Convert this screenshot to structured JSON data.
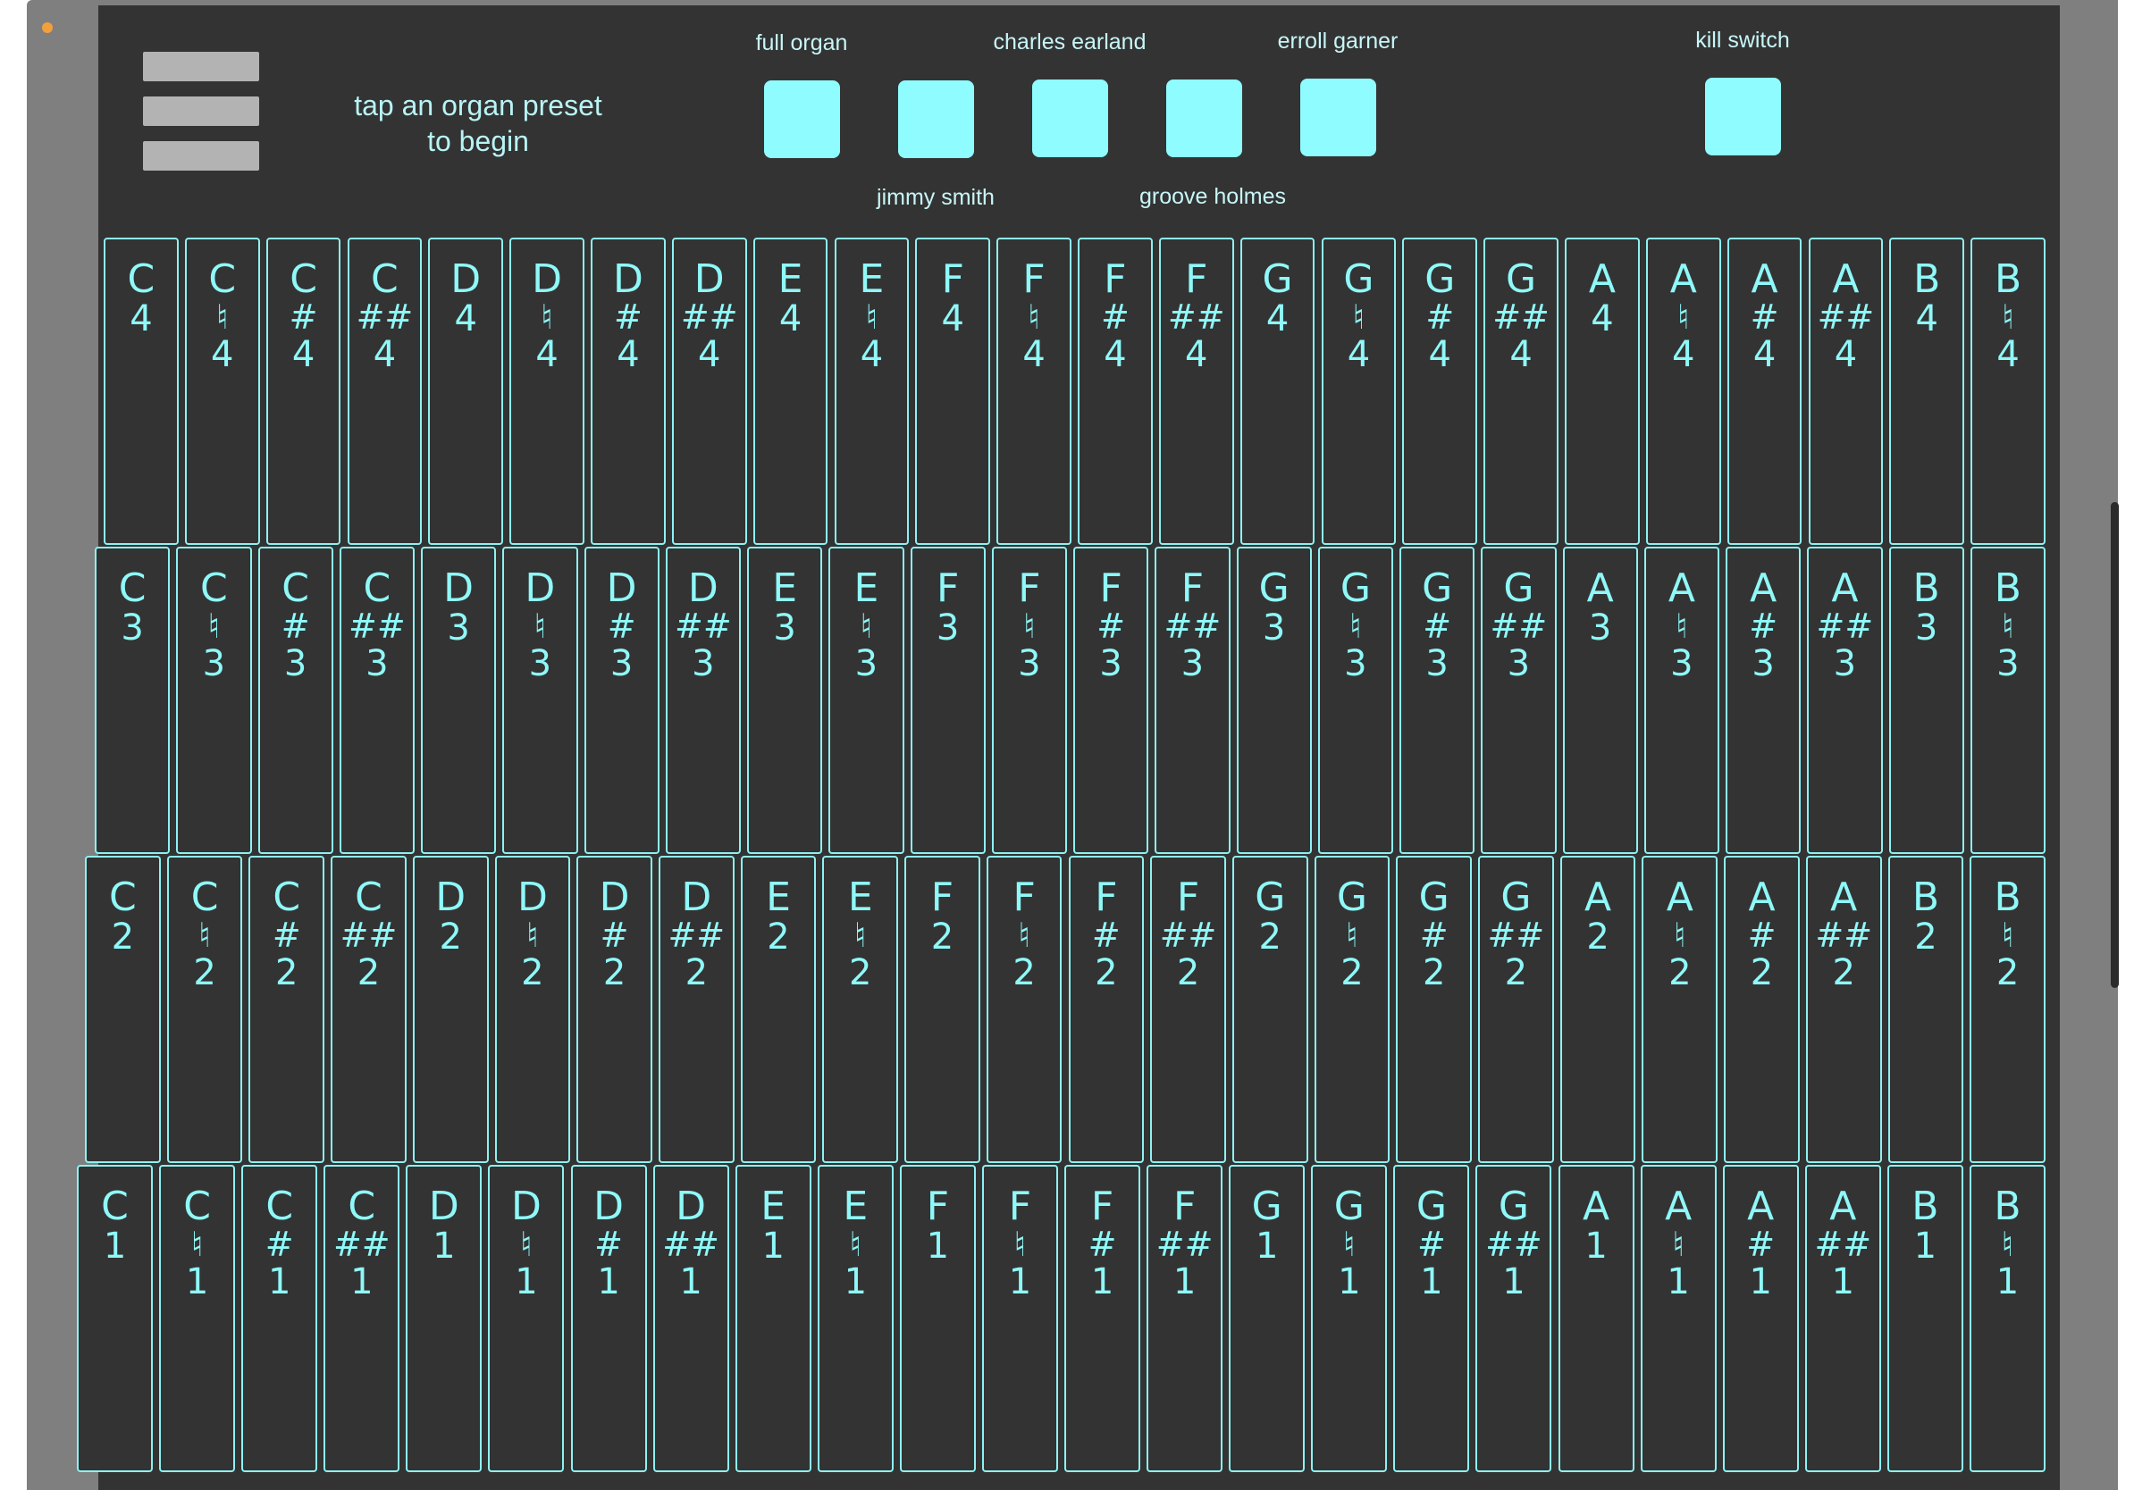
{
  "hint": "tap an organ preset\nto begin",
  "presets": [
    {
      "id": "full-organ",
      "label": "full organ",
      "label_pos": "top"
    },
    {
      "id": "jimmy-smith",
      "label": "jimmy smith",
      "label_pos": "bottom"
    },
    {
      "id": "charles-earland",
      "label": "charles earland",
      "label_pos": "top"
    },
    {
      "id": "groove-holmes",
      "label": "groove holmes",
      "label_pos": "bottom"
    },
    {
      "id": "erroll-garner",
      "label": "erroll garner",
      "label_pos": "top"
    }
  ],
  "kill_switch": {
    "label": "kill switch"
  },
  "colors": {
    "accent": "#8ffcff",
    "key_border": "#8ef1f1",
    "panel": "#333333"
  },
  "notes": [
    {
      "letter": "C",
      "mark": ""
    },
    {
      "letter": "C",
      "mark": "♮"
    },
    {
      "letter": "C",
      "mark": "#"
    },
    {
      "letter": "C",
      "mark": "##"
    },
    {
      "letter": "D",
      "mark": ""
    },
    {
      "letter": "D",
      "mark": "♮"
    },
    {
      "letter": "D",
      "mark": "#"
    },
    {
      "letter": "D",
      "mark": "##"
    },
    {
      "letter": "E",
      "mark": ""
    },
    {
      "letter": "E",
      "mark": "♮"
    },
    {
      "letter": "F",
      "mark": ""
    },
    {
      "letter": "F",
      "mark": "♮"
    },
    {
      "letter": "F",
      "mark": "#"
    },
    {
      "letter": "F",
      "mark": "##"
    },
    {
      "letter": "G",
      "mark": ""
    },
    {
      "letter": "G",
      "mark": "♮"
    },
    {
      "letter": "G",
      "mark": "#"
    },
    {
      "letter": "G",
      "mark": "##"
    },
    {
      "letter": "A",
      "mark": ""
    },
    {
      "letter": "A",
      "mark": "♮"
    },
    {
      "letter": "A",
      "mark": "#"
    },
    {
      "letter": "A",
      "mark": "##"
    },
    {
      "letter": "B",
      "mark": ""
    },
    {
      "letter": "B",
      "mark": "♮"
    }
  ],
  "octaves": [
    "4",
    "3",
    "2",
    "1"
  ]
}
